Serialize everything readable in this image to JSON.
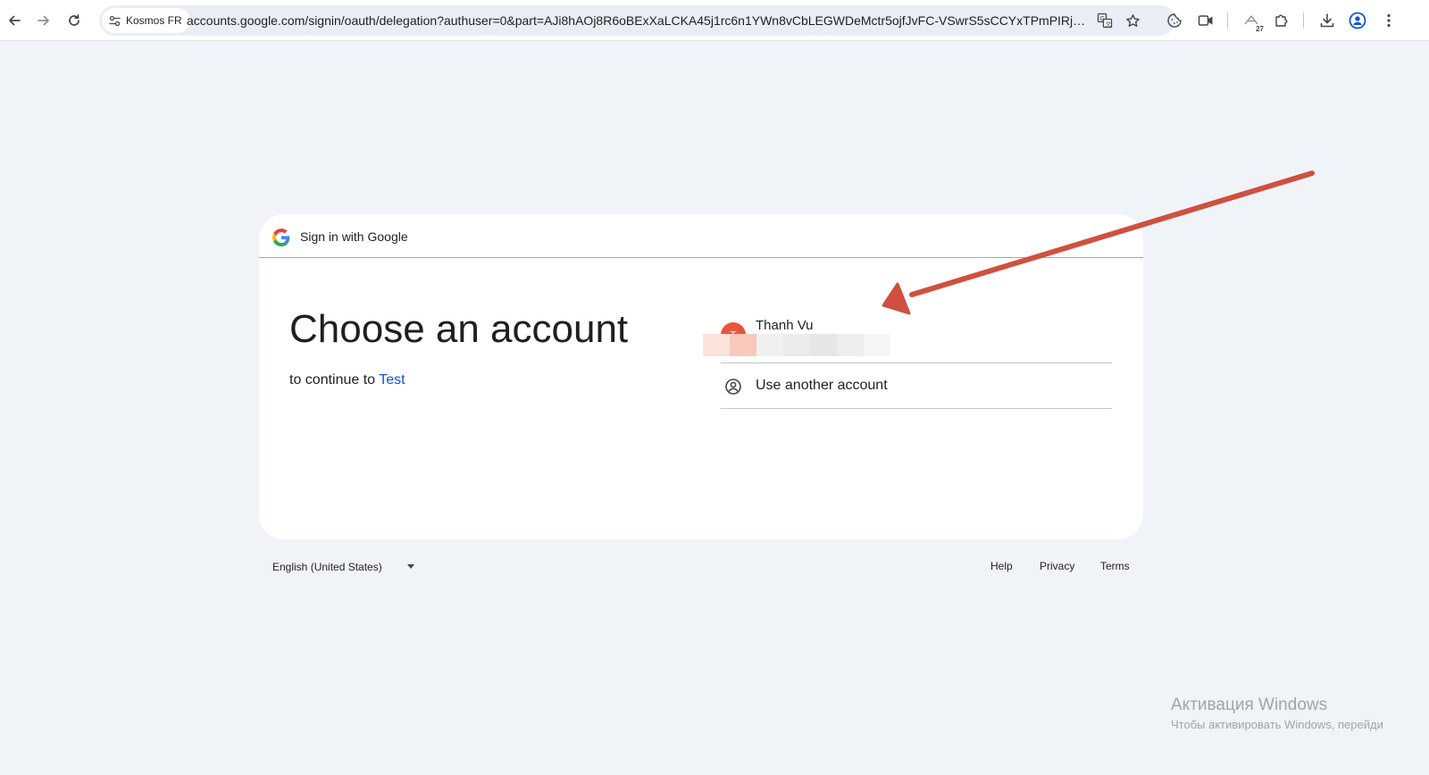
{
  "browser": {
    "site_chip_label": "Kosmos FR",
    "url": "accounts.google.com/signin/oauth/delegation?authuser=0&part=AJi8hAOj8R6oBExXaLCKA45j1rc6n1YWn8vCbLEGWDeMctr5ojfJvFC-VSwrS5sCCYxTPmPIRjEOVz_CAHz4Er...",
    "extension_badge_count": "27",
    "icons": {
      "back": "arrow-left-icon",
      "forward": "arrow-right-icon",
      "reload": "reload-icon",
      "site_settings": "tune-icon",
      "translate": "translate-icon",
      "bookmark": "star-icon",
      "extension_a": "cookie-icon",
      "extension_b": "video-camera-icon",
      "extension_c": "tab-counter-icon",
      "extensions": "puzzle-icon",
      "downloads": "download-icon",
      "profile": "profile-icon",
      "menu": "more-vertical-icon"
    }
  },
  "signin": {
    "header_title": "Sign in with Google",
    "headline": "Choose an account",
    "continue_prefix": "to continue to",
    "app_name": "Test",
    "account": {
      "name": "Thanh Vu",
      "initial": "T",
      "avatar_color": "#e8553e"
    },
    "use_another_label": "Use another account"
  },
  "footer": {
    "language": "English (United States)",
    "links": {
      "help": "Help",
      "privacy": "Privacy",
      "terms": "Terms"
    }
  },
  "watermark": {
    "title": "Активация Windows",
    "subtitle": "Чтобы активировать Windows, перейди"
  },
  "colors": {
    "page_background": "#f0f4f9",
    "link_blue": "#0b57d0",
    "annotation_arrow": "#d0503f"
  }
}
